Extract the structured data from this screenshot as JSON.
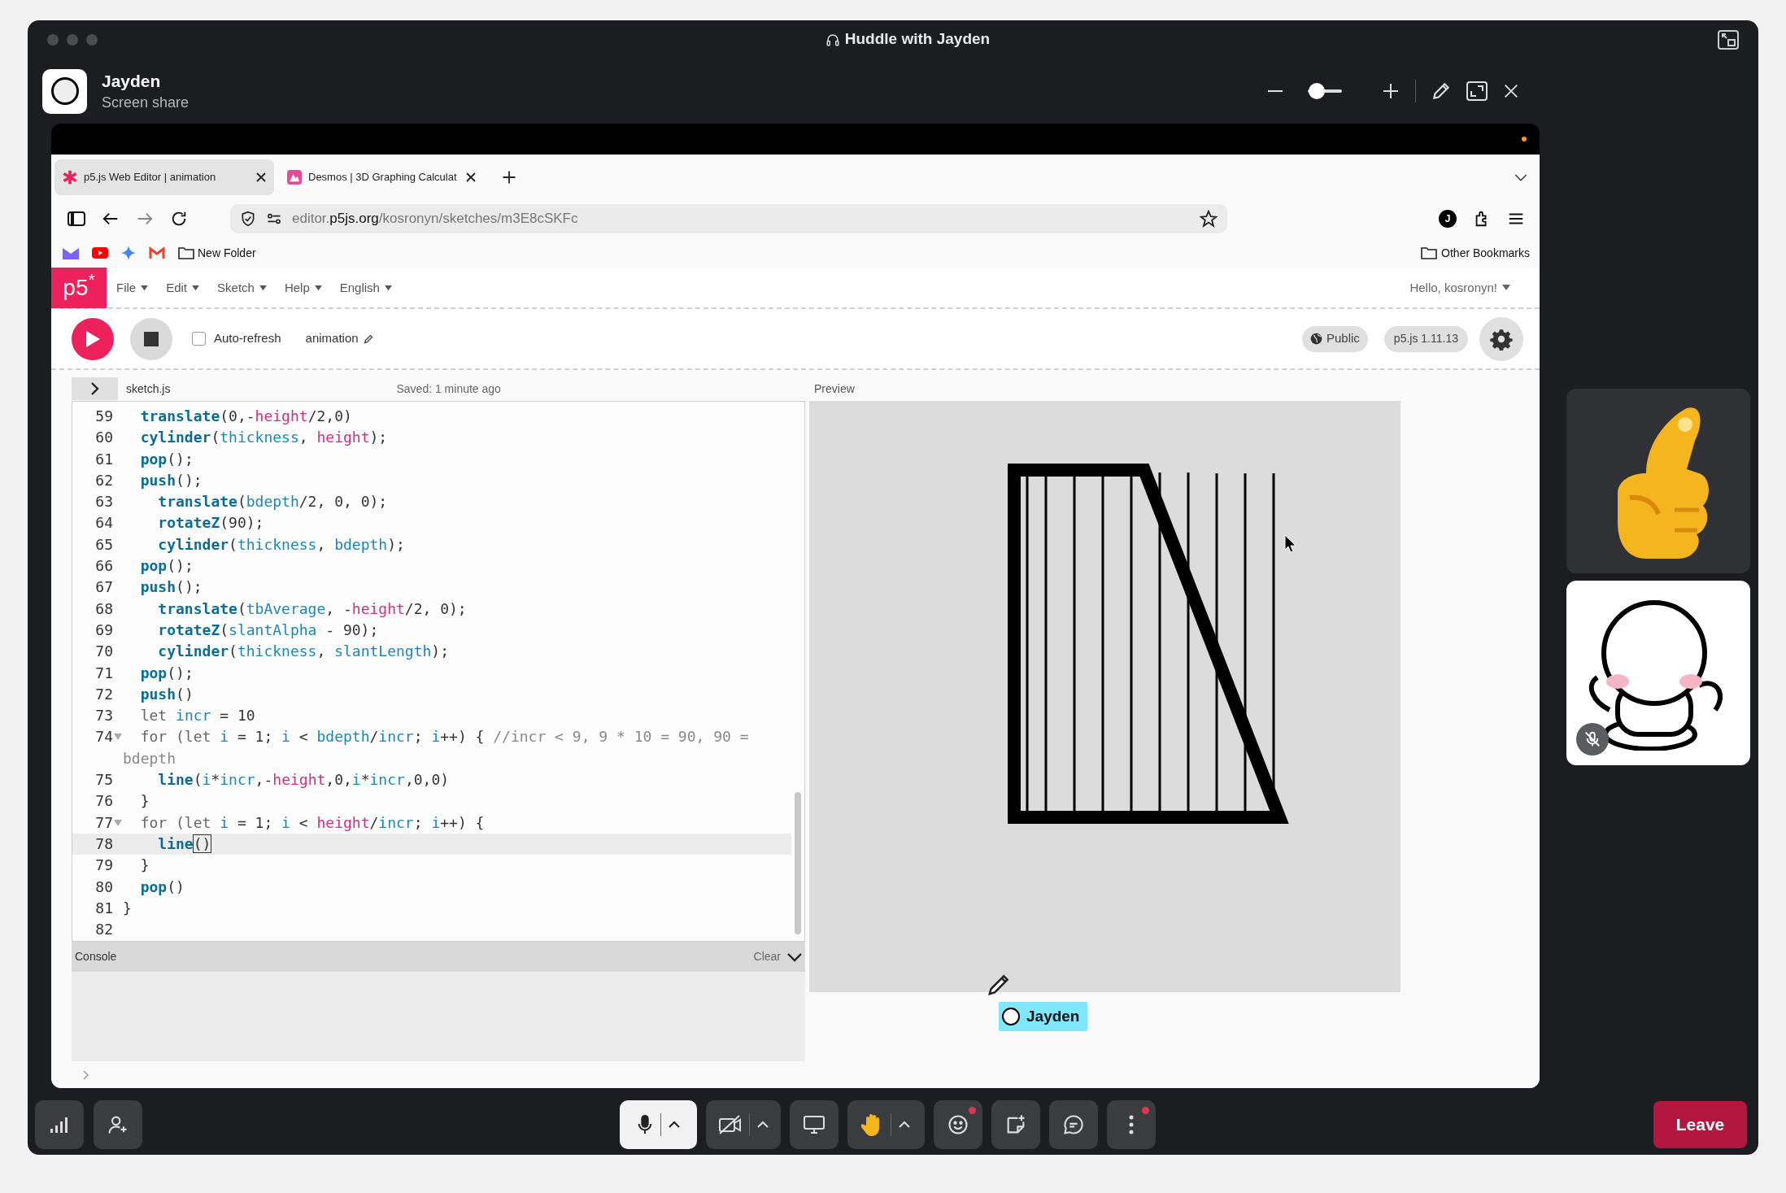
{
  "window": {
    "title": "Huddle with Jayden"
  },
  "share_header": {
    "name": "Jayden",
    "subtitle": "Screen share",
    "zoom": {
      "level": 0.25
    }
  },
  "browser": {
    "tabs": [
      {
        "label": "p5.js Web Editor | animation",
        "selected": true
      },
      {
        "label": "Desmos | 3D Graphing Calculat",
        "selected": false
      }
    ],
    "url": {
      "host_prefix": "editor.",
      "host": "p5js.org",
      "path": "/kosronyn/sketches/m3E8cSKFc"
    },
    "profile_initial": "J",
    "bookmark_folder": "New Folder",
    "other_bookmarks": "Other Bookmarks"
  },
  "editor": {
    "logo": "p5$^{*}$",
    "menus": [
      "File",
      "Edit",
      "Sketch",
      "Help",
      "English"
    ],
    "greeting": "Hello, kosronyn!",
    "auto_refresh": {
      "label": "Auto-refresh",
      "checked": false
    },
    "sketch_name": "animation",
    "visibility": "Public",
    "version": "p5.js 1.11.13",
    "file_name": "sketch.js",
    "saved": "Saved: 1 minute ago",
    "preview_label": "Preview",
    "code": [
      {
        "n": "59",
        "fold": false,
        "current": false,
        "tokens": [
          {
            "text": "  translate",
            "kind": "fn"
          },
          {
            "text": "(0,-",
            "kind": "plain"
          },
          {
            "text": "height",
            "kind": "prop"
          },
          {
            "text": "/2,0)",
            "kind": "plain"
          }
        ]
      },
      {
        "n": "60",
        "fold": false,
        "current": false,
        "tokens": [
          {
            "text": "  cylinder",
            "kind": "fn"
          },
          {
            "text": "(",
            "kind": "plain"
          },
          {
            "text": "thickness",
            "kind": "var"
          },
          {
            "text": ", ",
            "kind": "plain"
          },
          {
            "text": "height",
            "kind": "prop"
          },
          {
            "text": ");",
            "kind": "plain"
          }
        ]
      },
      {
        "n": "61",
        "fold": false,
        "current": false,
        "tokens": [
          {
            "text": "  pop",
            "kind": "fn"
          },
          {
            "text": "();",
            "kind": "plain"
          }
        ]
      },
      {
        "n": "62",
        "fold": false,
        "current": false,
        "tokens": [
          {
            "text": "  push",
            "kind": "fn"
          },
          {
            "text": "();",
            "kind": "plain"
          }
        ]
      },
      {
        "n": "63",
        "fold": false,
        "current": false,
        "tokens": [
          {
            "text": "    translate",
            "kind": "fn"
          },
          {
            "text": "(",
            "kind": "plain"
          },
          {
            "text": "bdepth",
            "kind": "var"
          },
          {
            "text": "/2, 0, 0);",
            "kind": "plain"
          }
        ]
      },
      {
        "n": "64",
        "fold": false,
        "current": false,
        "tokens": [
          {
            "text": "    rotateZ",
            "kind": "fn"
          },
          {
            "text": "(90);",
            "kind": "plain"
          }
        ]
      },
      {
        "n": "65",
        "fold": false,
        "current": false,
        "tokens": [
          {
            "text": "    cylinder",
            "kind": "fn"
          },
          {
            "text": "(",
            "kind": "plain"
          },
          {
            "text": "thickness",
            "kind": "var"
          },
          {
            "text": ", ",
            "kind": "plain"
          },
          {
            "text": "bdepth",
            "kind": "var"
          },
          {
            "text": ");",
            "kind": "plain"
          }
        ]
      },
      {
        "n": "66",
        "fold": false,
        "current": false,
        "tokens": [
          {
            "text": "  pop",
            "kind": "fn"
          },
          {
            "text": "();",
            "kind": "plain"
          }
        ]
      },
      {
        "n": "67",
        "fold": false,
        "current": false,
        "tokens": [
          {
            "text": "  push",
            "kind": "fn"
          },
          {
            "text": "();",
            "kind": "plain"
          }
        ]
      },
      {
        "n": "68",
        "fold": false,
        "current": false,
        "tokens": [
          {
            "text": "    translate",
            "kind": "fn"
          },
          {
            "text": "(",
            "kind": "plain"
          },
          {
            "text": "tbAverage",
            "kind": "var"
          },
          {
            "text": ", -",
            "kind": "plain"
          },
          {
            "text": "height",
            "kind": "prop"
          },
          {
            "text": "/2, 0);",
            "kind": "plain"
          }
        ]
      },
      {
        "n": "69",
        "fold": false,
        "current": false,
        "tokens": [
          {
            "text": "    rotateZ",
            "kind": "fn"
          },
          {
            "text": "(",
            "kind": "plain"
          },
          {
            "text": "slantAlpha",
            "kind": "var"
          },
          {
            "text": " - 90);",
            "kind": "plain"
          }
        ]
      },
      {
        "n": "70",
        "fold": false,
        "current": false,
        "tokens": [
          {
            "text": "    cylinder",
            "kind": "fn"
          },
          {
            "text": "(",
            "kind": "plain"
          },
          {
            "text": "thickness",
            "kind": "var"
          },
          {
            "text": ", ",
            "kind": "plain"
          },
          {
            "text": "slantLength",
            "kind": "var"
          },
          {
            "text": ");",
            "kind": "plain"
          }
        ]
      },
      {
        "n": "71",
        "fold": false,
        "current": false,
        "tokens": [
          {
            "text": "  pop",
            "kind": "fn"
          },
          {
            "text": "();",
            "kind": "plain"
          }
        ]
      },
      {
        "n": "72",
        "fold": false,
        "current": false,
        "tokens": [
          {
            "text": "  push",
            "kind": "fn"
          },
          {
            "text": "()",
            "kind": "plain"
          }
        ]
      },
      {
        "n": "73",
        "fold": false,
        "current": false,
        "tokens": [
          {
            "text": "  let ",
            "kind": "keyword"
          },
          {
            "text": "incr",
            "kind": "var"
          },
          {
            "text": " = 10",
            "kind": "plain"
          }
        ]
      },
      {
        "n": "74",
        "fold": true,
        "current": false,
        "tokens": [
          {
            "text": "  for (let ",
            "kind": "keyword"
          },
          {
            "text": "i",
            "kind": "var"
          },
          {
            "text": " = 1; ",
            "kind": "plain"
          },
          {
            "text": "i",
            "kind": "var"
          },
          {
            "text": " < ",
            "kind": "plain"
          },
          {
            "text": "bdepth",
            "kind": "var"
          },
          {
            "text": "/",
            "kind": "plain"
          },
          {
            "text": "incr",
            "kind": "var"
          },
          {
            "text": "; ",
            "kind": "plain"
          },
          {
            "text": "i",
            "kind": "var"
          },
          {
            "text": "++) { ",
            "kind": "plain"
          },
          {
            "text": "//incr < 9, 9 * 10 = 90, 90 = bdepth",
            "kind": "comment"
          }
        ]
      },
      {
        "n": "75",
        "fold": false,
        "current": false,
        "tokens": [
          {
            "text": "    line",
            "kind": "fn"
          },
          {
            "text": "(",
            "kind": "plain"
          },
          {
            "text": "i",
            "kind": "var"
          },
          {
            "text": "*",
            "kind": "plain"
          },
          {
            "text": "incr",
            "kind": "var"
          },
          {
            "text": ",-",
            "kind": "plain"
          },
          {
            "text": "height",
            "kind": "prop"
          },
          {
            "text": ",0,",
            "kind": "plain"
          },
          {
            "text": "i",
            "kind": "var"
          },
          {
            "text": "*",
            "kind": "plain"
          },
          {
            "text": "incr",
            "kind": "var"
          },
          {
            "text": ",0,0)",
            "kind": "plain"
          }
        ]
      },
      {
        "n": "76",
        "fold": false,
        "current": false,
        "tokens": [
          {
            "text": "  }",
            "kind": "plain"
          }
        ]
      },
      {
        "n": "77",
        "fold": true,
        "current": false,
        "tokens": [
          {
            "text": "  for (let ",
            "kind": "keyword"
          },
          {
            "text": "i",
            "kind": "var"
          },
          {
            "text": " = 1; ",
            "kind": "plain"
          },
          {
            "text": "i",
            "kind": "var"
          },
          {
            "text": " < ",
            "kind": "plain"
          },
          {
            "text": "height",
            "kind": "prop"
          },
          {
            "text": "/",
            "kind": "plain"
          },
          {
            "text": "incr",
            "kind": "var"
          },
          {
            "text": "; ",
            "kind": "plain"
          },
          {
            "text": "i",
            "kind": "var"
          },
          {
            "text": "++) {",
            "kind": "plain"
          }
        ]
      },
      {
        "n": "78",
        "fold": false,
        "current": true,
        "tokens": [
          {
            "text": "    line",
            "kind": "fn"
          },
          {
            "text": "()",
            "kind": "match"
          }
        ]
      },
      {
        "n": "79",
        "fold": false,
        "current": false,
        "tokens": [
          {
            "text": "  }",
            "kind": "plain"
          }
        ]
      },
      {
        "n": "80",
        "fold": false,
        "current": false,
        "tokens": [
          {
            "text": "  pop",
            "kind": "fn"
          },
          {
            "text": "()",
            "kind": "plain"
          }
        ]
      },
      {
        "n": "81",
        "fold": false,
        "current": false,
        "tokens": [
          {
            "text": "}",
            "kind": "plain"
          }
        ]
      },
      {
        "n": "82",
        "fold": false,
        "current": false
      }
    ],
    "console": {
      "label": "Console",
      "clear": "Clear"
    }
  },
  "cursor_tag": {
    "name": "Jayden"
  },
  "participants": [
    {
      "kind": "sticker",
      "muted": false
    },
    {
      "kind": "avatar",
      "muted": true
    }
  ],
  "controls": {
    "mic_on": true,
    "camera_on": false,
    "reactions_badge": true,
    "more_badge": true,
    "leave": "Leave"
  }
}
